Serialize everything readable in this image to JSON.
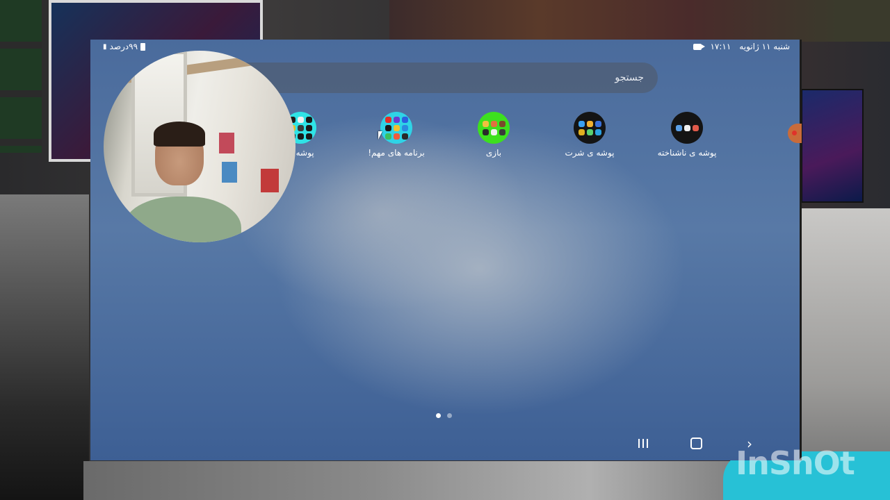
{
  "status_bar": {
    "datetime": "شنبه ۱۱ ژانویه",
    "time": "۱۷:۱۱",
    "battery": "۹۹درصد"
  },
  "search": {
    "placeholder": "جستجو"
  },
  "folders": [
    {
      "label": "پوشه ی ناشناخته",
      "bg": "#141414",
      "icon_colors": [
        "#5aa0e8",
        "#f0f0f0",
        "#e05a4a"
      ]
    },
    {
      "label": "پوشه ی شرت",
      "bg": "#141414",
      "icon_colors": [
        "#3aa0f0",
        "#f0b030",
        "#3a70d8",
        "#e0b020",
        "#5ad070",
        "#2aa0e0"
      ]
    },
    {
      "label": "بازی",
      "bg": "#3de01e",
      "icon_colors": [
        "#f0c040",
        "#e07040",
        "#7a4a2a",
        "#2a2a2a",
        "#f0f0f0",
        "#3a3a3a"
      ]
    },
    {
      "label": "برنامه های مهم!",
      "bg": "#2fd3e6",
      "icon_colors": [
        "#e0302a",
        "#6a3ad0",
        "#2a60e0",
        "#1a1a1a",
        "#f0c030",
        "#2a8ae0",
        "#3ac060",
        "#f05a3a",
        "#2a2a2a"
      ]
    },
    {
      "label": "پوشه ی",
      "bg": "#2fe3e6",
      "icon_colors": [
        "#1a1a1a",
        "#f0f0f0",
        "#1a1a1a",
        "#e0c030",
        "#3a3a3a",
        "#1a1a1a",
        "#1a1a1a",
        "#1a1a1a",
        "#1a1a1a"
      ]
    }
  ],
  "page_indicator": {
    "count": 2,
    "active": 1
  },
  "nav_bar": {
    "recent": "recent-apps",
    "home": "home",
    "back": "back"
  },
  "watermark": "InShOt"
}
